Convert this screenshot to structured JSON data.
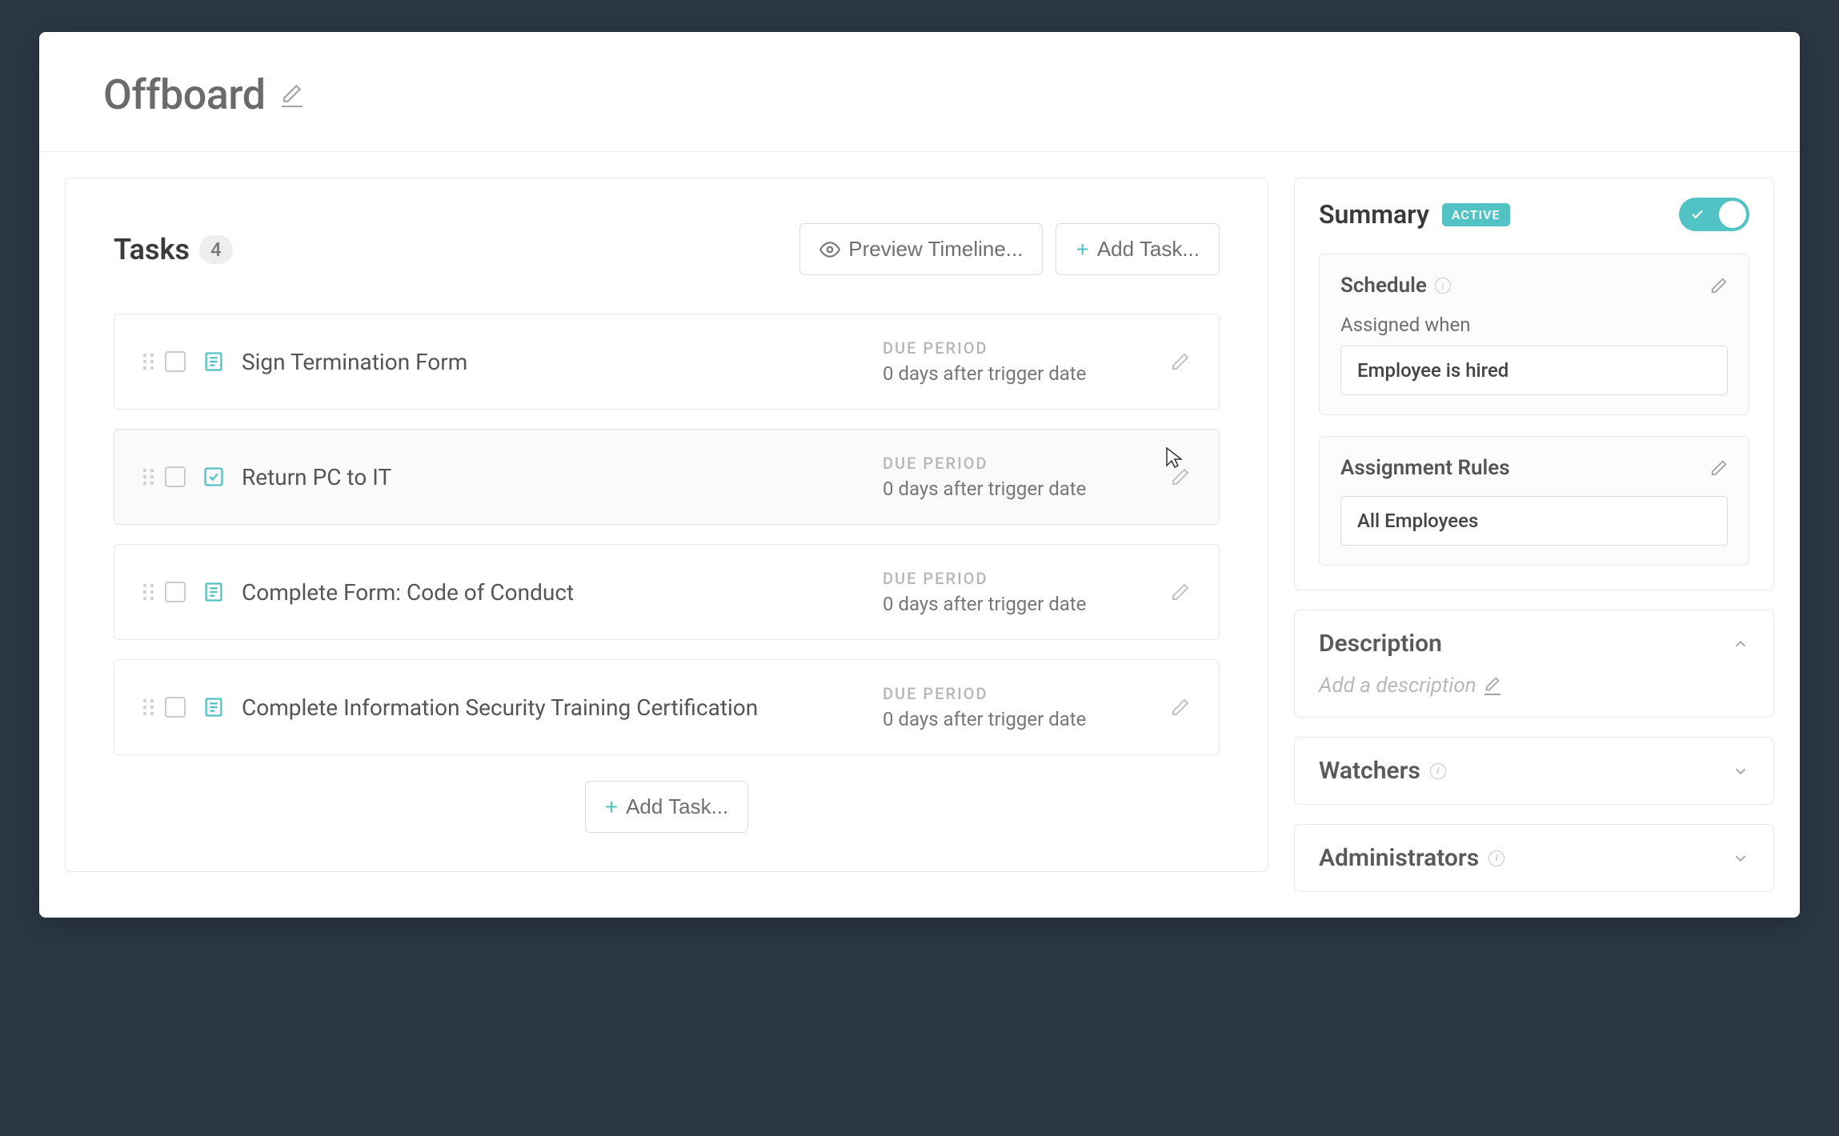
{
  "page": {
    "title": "Offboard"
  },
  "tasks_section": {
    "heading": "Tasks",
    "count": "4",
    "preview_button": "Preview Timeline...",
    "add_button_top": "Add Task...",
    "add_button_bottom": "Add Task...",
    "due_period_label": "DUE PERIOD"
  },
  "tasks": [
    {
      "name": "Sign Termination Form",
      "icon": "form",
      "due": "0 days after trigger date",
      "hover": false
    },
    {
      "name": "Return PC to IT",
      "icon": "check",
      "due": "0 days after trigger date",
      "hover": true
    },
    {
      "name": "Complete Form: Code of Conduct",
      "icon": "form",
      "due": "0 days after trigger date",
      "hover": false
    },
    {
      "name": "Complete Information Security Training Certification",
      "icon": "form",
      "due": "0 days after trigger date",
      "hover": false
    }
  ],
  "summary": {
    "title": "Summary",
    "status_pill": "ACTIVE",
    "toggle_on": true,
    "schedule": {
      "title": "Schedule",
      "assigned_when_label": "Assigned when",
      "assigned_when_value": "Employee is hired"
    },
    "assignment_rules": {
      "title": "Assignment Rules",
      "value": "All Employees"
    }
  },
  "description_panel": {
    "title": "Description",
    "placeholder": "Add a description",
    "expanded": true
  },
  "watchers_panel": {
    "title": "Watchers",
    "expanded": false
  },
  "admins_panel": {
    "title": "Administrators",
    "expanded": false
  },
  "colors": {
    "accent": "#52c3c4",
    "bg": "#2b3844"
  }
}
